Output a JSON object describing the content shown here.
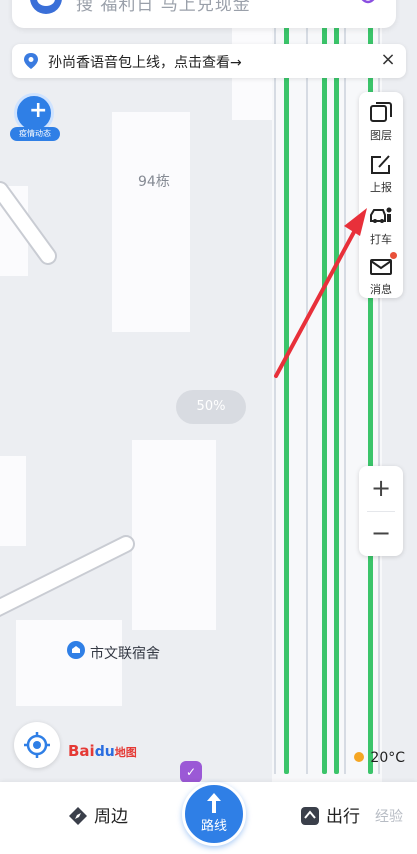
{
  "search": {
    "text": "搜 福利日 马上兑现金"
  },
  "notice": {
    "text": "孙尚香语音包上线，点击查看→",
    "close": "×"
  },
  "epidemic": {
    "plus": "+",
    "label": "疫情动态"
  },
  "map": {
    "building_label": "94栋",
    "poi_label": "市文联宿舍",
    "percent_chip": "50%"
  },
  "toolbar": {
    "items": [
      {
        "label": "图层",
        "icon": "layers-icon"
      },
      {
        "label": "上报",
        "icon": "report-icon"
      },
      {
        "label": "打车",
        "icon": "taxi-icon"
      },
      {
        "label": "消息",
        "icon": "mail-icon"
      }
    ]
  },
  "zoom": {
    "in": "+",
    "out": "−"
  },
  "logo": {
    "part1": "Bai",
    "paw": "du",
    "part2": "地图"
  },
  "weather": {
    "temp": "20°C"
  },
  "bag": {
    "glyph": "✓"
  },
  "bottom_nav": {
    "nearby": "周边",
    "route": "路线",
    "travel": "出行"
  },
  "watermark": "经验",
  "colors": {
    "accent": "#2f7fe6",
    "green_route": "#3bc46a",
    "annotation": "#e8303a"
  }
}
